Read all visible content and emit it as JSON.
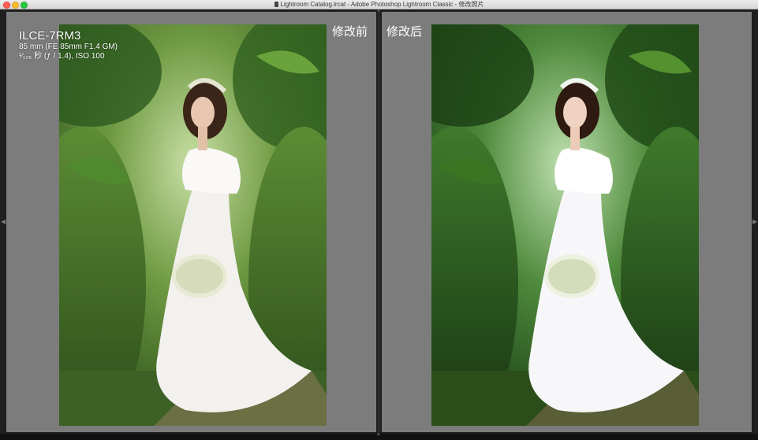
{
  "window": {
    "title": "Lightroom Catalog.lrcat - Adobe Photoshop Lightroom Classic - 修改照片"
  },
  "metadata": {
    "camera": "ILCE-7RM3",
    "lens": "85 mm (FE 85mm F1.4 GM)",
    "exposure": "¹⁄₁₂₅ 秒 (ƒ / 1.4), ISO 100"
  },
  "compare": {
    "before_label": "修改前",
    "after_label": "修改后"
  },
  "photo": {
    "subject": "woman in white gown holding bouquet in greenery",
    "before_tone": "#3f6a2a",
    "after_tone": "#2d5524"
  }
}
